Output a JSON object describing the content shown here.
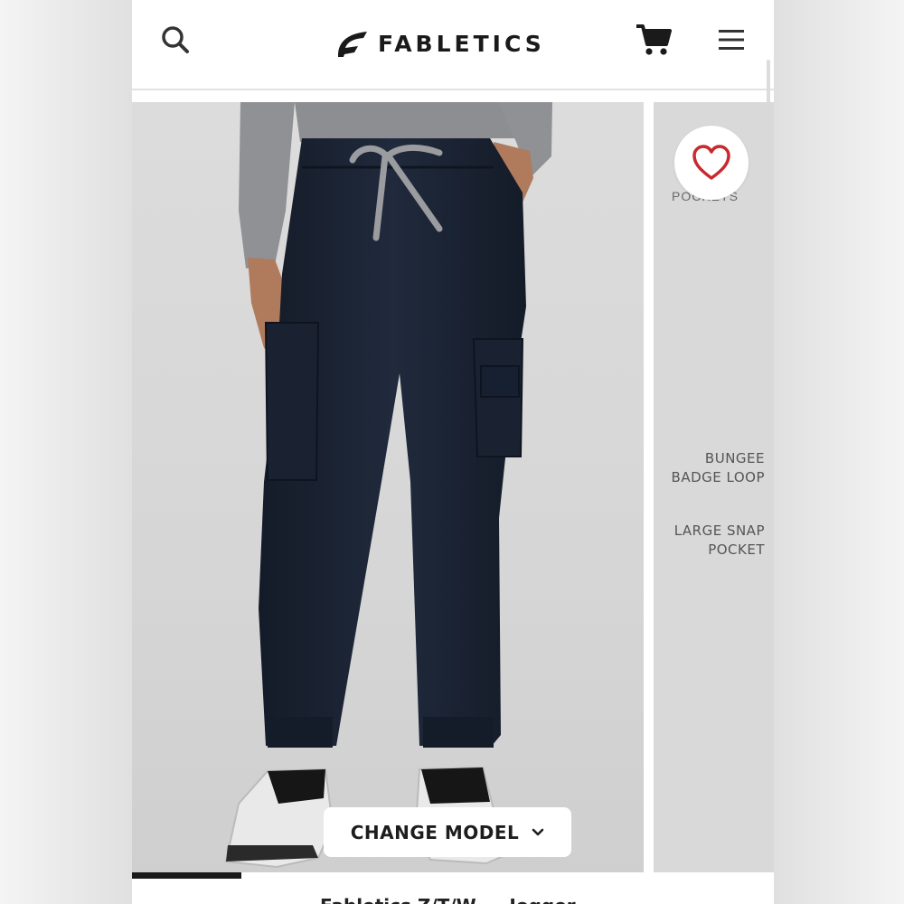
{
  "header": {
    "brand_name": "FABLETICS",
    "search_icon": "search-icon",
    "cart_icon": "cart-icon",
    "menu_icon": "hamburger-menu-icon"
  },
  "gallery": {
    "favorite_icon": "heart-outline-icon",
    "change_model_label": "CHANGE MODEL",
    "change_model_icon": "chevron-down-icon",
    "progress_fraction": 0.17,
    "second_image": {
      "partial_label": "POCKETS",
      "callouts": [
        {
          "line1": "BUNGEE",
          "line2": "BADGE LOOP"
        },
        {
          "line1": "LARGE SNAP",
          "line2": "POCKET"
        }
      ]
    }
  },
  "product": {
    "title_partial": "Fabletics Z/T/W ... Jogger"
  },
  "colors": {
    "accent_heart": "#c8282e",
    "progress_fill": "#1a1a1a",
    "pants_navy": "#1c2433"
  }
}
